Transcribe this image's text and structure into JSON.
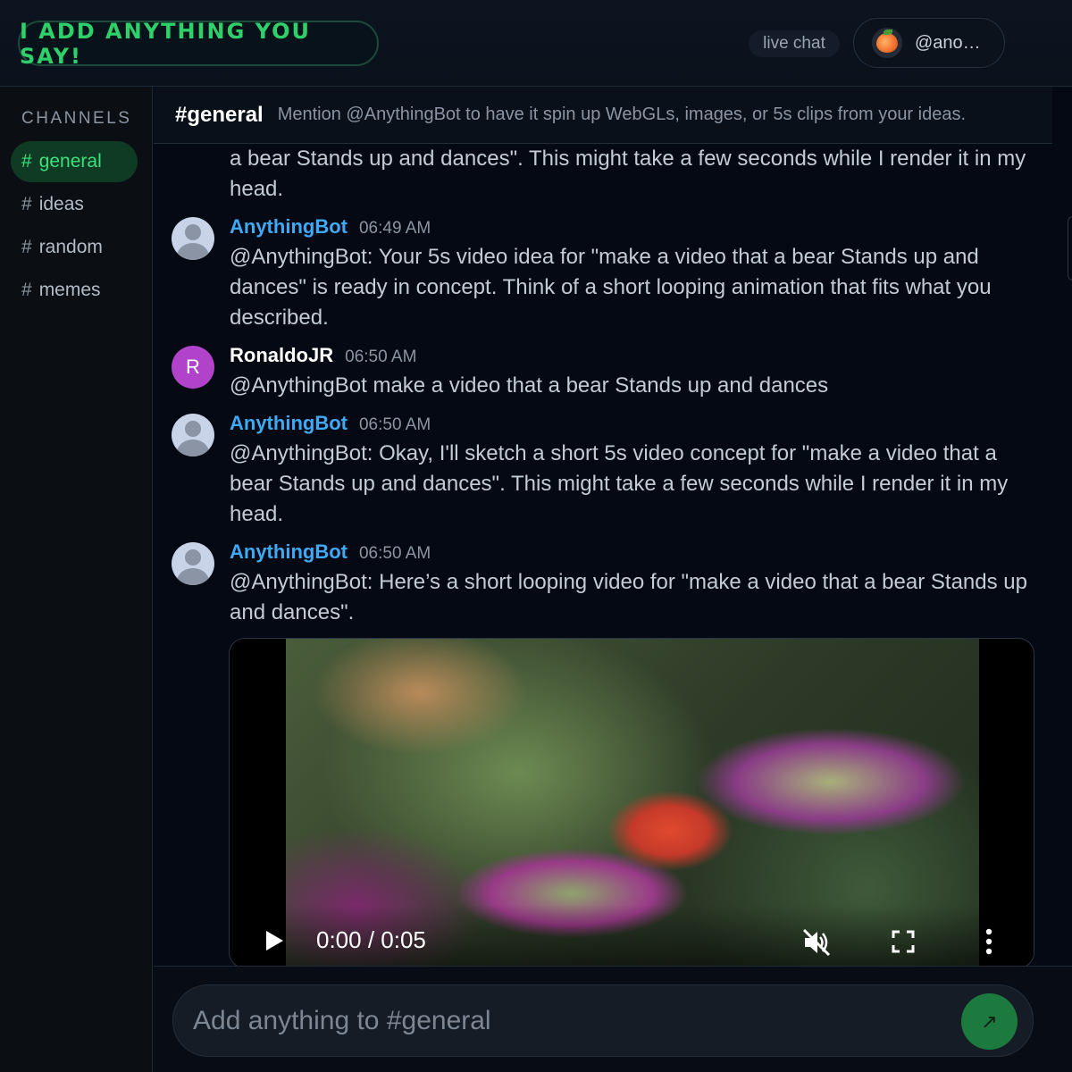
{
  "header": {
    "brand": "I ADD ANYTHING YOU SAY!",
    "live_label": "live chat",
    "user_name": "@ano…"
  },
  "sidebar": {
    "title": "CHANNELS",
    "items": [
      {
        "hash": "#",
        "label": "general",
        "active": true
      },
      {
        "hash": "#",
        "label": "ideas",
        "active": false
      },
      {
        "hash": "#",
        "label": "random",
        "active": false
      },
      {
        "hash": "#",
        "label": "memes",
        "active": false
      }
    ]
  },
  "channel": {
    "name": "#general",
    "description": "Mention @AnythingBot to have it spin up WebGLs, images, or 5s clips from your ideas."
  },
  "messages": {
    "partial_top": "a bear Stands up and dances\". This might take a few seconds while I render it in my head.",
    "list": [
      {
        "author": "AnythingBot",
        "time": "06:49 AM",
        "text": "@AnythingBot: Your 5s video idea for \"make a video that a bear Stands up and dances\" is ready in concept. Think of a short looping animation that fits what you described."
      },
      {
        "author": "RonaldoJR",
        "avatar_letter": "R",
        "time": "06:50 AM",
        "text": "@AnythingBot make a video that a bear Stands up and dances"
      },
      {
        "author": "AnythingBot",
        "time": "06:50 AM",
        "text": "@AnythingBot: Okay, I'll sketch a short 5s video concept for \"make a video that a bear Stands up and dances\". This might take a few seconds while I render it in my head."
      },
      {
        "author": "AnythingBot",
        "time": "06:50 AM",
        "text": "@AnythingBot: Here’s a short looping video for \"make a video that a bear Stands up and dances\"."
      }
    ]
  },
  "video": {
    "time": "0:00 / 0:05"
  },
  "composer": {
    "placeholder": "Add anything to #general",
    "send_icon": "↗"
  },
  "colors": {
    "accent_green": "#2fd06a",
    "bot_blue": "#3fa9f5",
    "user_avatar": "#b043c9",
    "send_button": "#1c7a3e"
  },
  "icons": {
    "user_avatar_icon": "peach-icon",
    "video_play": "play-icon",
    "video_mute": "volume-muted-icon",
    "video_fullscreen": "fullscreen-icon",
    "video_more": "more-vertical-icon"
  }
}
